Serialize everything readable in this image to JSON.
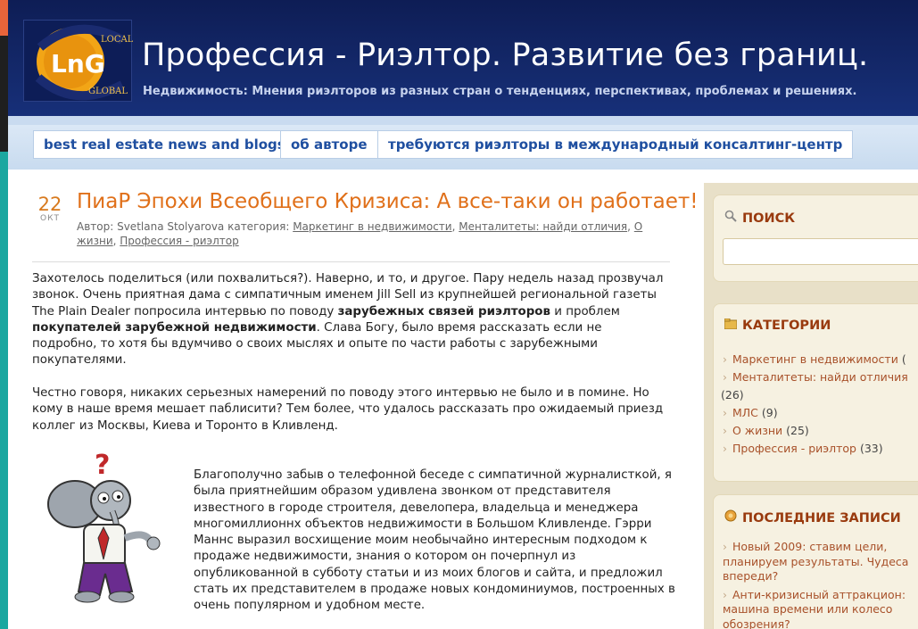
{
  "header": {
    "logo_text": [
      "LOCAL",
      "LnG",
      "GLOBAL"
    ],
    "title": "Профессия - Риэлтор. Развитие без границ.",
    "subtitle": "Недвижимость: Мнения риэлторов из разных стран о тенденциях, перспективах, проблемах и решениях."
  },
  "nav": {
    "items": [
      "best real estate news and blogs",
      "об авторе",
      "требуются риэлторы в международный консалтинг-центр"
    ]
  },
  "post": {
    "day": "22",
    "month": "ОКТ",
    "title": "ПиаР Эпохи Всеобщего Кризиса: А все-таки он работает!",
    "meta_prefix": "Автор: Svetlana Stolyarova категория: ",
    "categories": [
      "Маркетинг в недвижимости",
      "Менталитеты: найди отличия",
      "О жизни",
      "Профессия - риэлтор"
    ],
    "p1_a": "Захотелось поделиться (или похвалиться?). Наверно, и то, и другое. Пару недель назад прозвучал звонок. Очень приятная дама с симпатичным именем Jill Sell из крупнейшей региональной газеты The Plain Dealer попросила интервью по поводу ",
    "p1_b1": "зарубежных связей риэлторов",
    "p1_c": " и проблем ",
    "p1_b2": "покупателей зарубежной недвижимости",
    "p1_d": ".  Слава Богу, было время рассказать если не подробно, то хотя бы вдумчиво о своих мыслях и опыте по части работы с зарубежными покупателями.",
    "p2": "Честно говоря, никаких серьезных намерений по поводу этого интервью не было и в помине. Но кому в наше время мешает паблисити? Тем более, что удалось рассказать про ожидаемый приезд коллег из Москвы, Киева и Торонто в Кливленд.",
    "p3": "Благополучно забыв о телефонной беседе с симпатичной журналисткой, я была приятнейшим образом удивлена звонком от представителя известного в городе строителя, девелопера, владельца и менеджера многомиллионнх объектов недвижимости в Большом Кливленде. Гэрри Маннс выразил восхищение моим необычайно интересным подходом к продаже недвижимости, знания о котором он почерпнул из опубликованной в субботу статьи и из моих блогов и сайта, и предложил стать их представителем в продаже новых кондоминиумов, построенных в очень популярном и удобном месте."
  },
  "sidebar": {
    "search_title": "ПОИСК",
    "categories_title": "КАТЕГОРИИ",
    "categories": [
      {
        "label": "Маркетинг в недвижимости",
        "count": "(",
        "extra": ""
      },
      {
        "label": "Менталитеты: найди отличия",
        "count": "",
        "extra": "(26)"
      },
      {
        "label": "МЛС",
        "count": "(9)",
        "extra": ""
      },
      {
        "label": "О жизни",
        "count": "(25)",
        "extra": ""
      },
      {
        "label": "Профессия - риэлтор",
        "count": "(33)",
        "extra": ""
      }
    ],
    "recent_title": "ПОСЛЕДНИЕ ЗАПИСИ",
    "recent": [
      "Новый 2009: ставим цели, планируем результаты. Чудеса впереди?",
      "Анти-кризисный аттракцион: машина времени или колесо обозрения?"
    ]
  }
}
